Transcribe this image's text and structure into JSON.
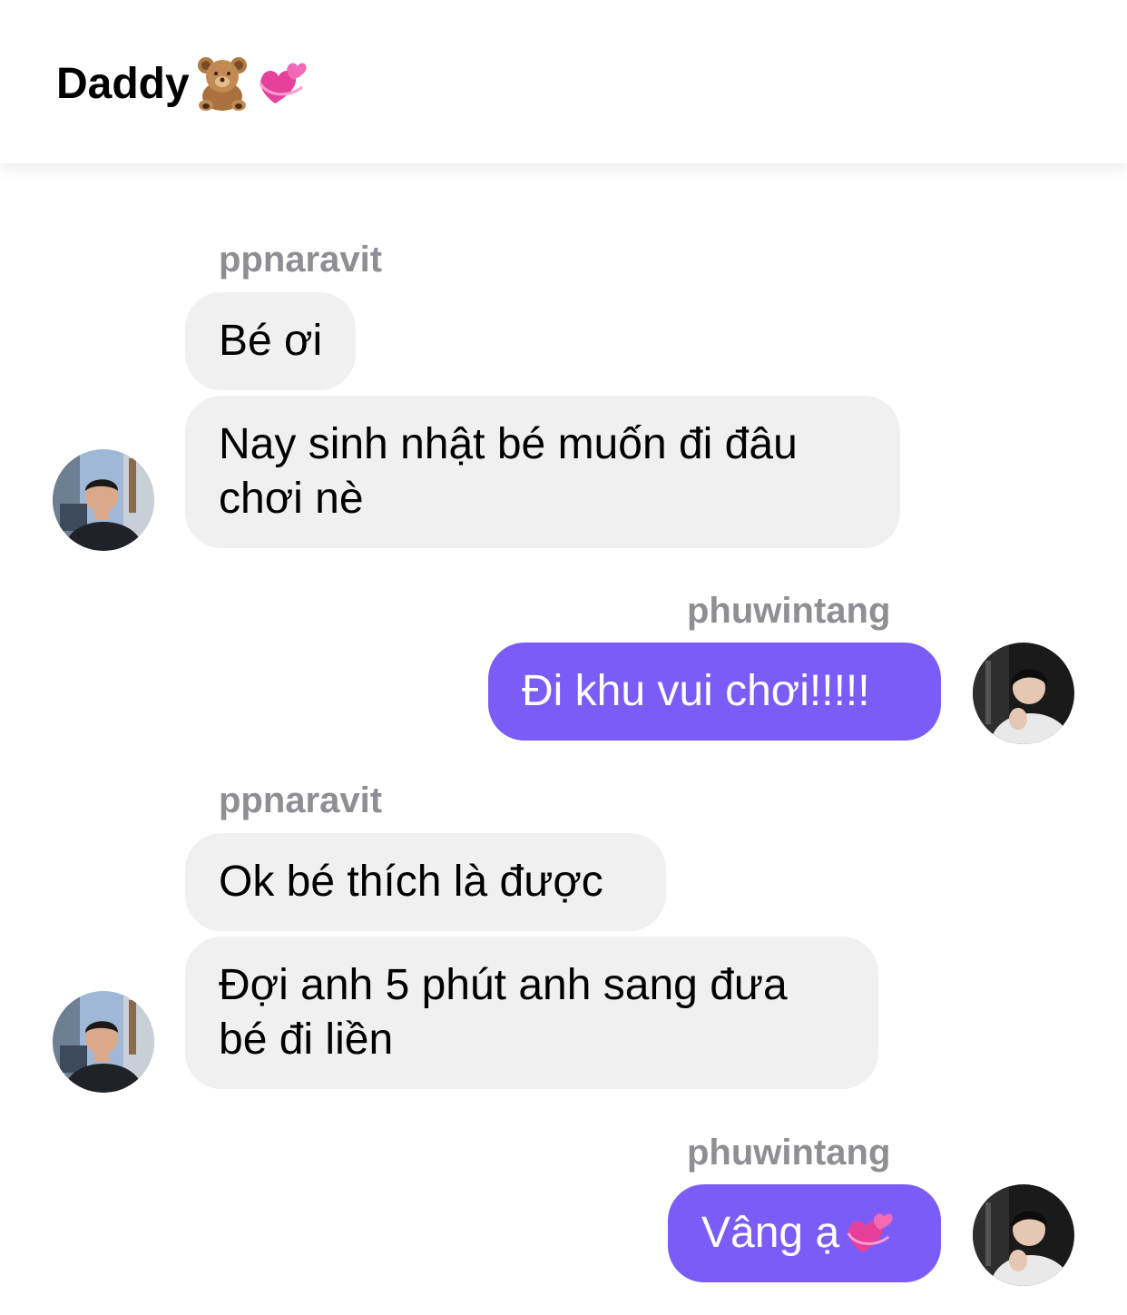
{
  "header": {
    "title": "Daddy",
    "title_emojis": [
      "teddy-bear",
      "revolving-hearts"
    ]
  },
  "messages": [
    {
      "sender": "ppnaravit",
      "direction": "incoming",
      "text": "Bé ơi"
    },
    {
      "sender": "ppnaravit",
      "direction": "incoming",
      "text": "Nay sinh nhật bé muốn đi đâu chơi nè"
    },
    {
      "sender": "phuwintang",
      "direction": "outgoing",
      "text": "Đi khu vui chơi!!!!!"
    },
    {
      "sender": "ppnaravit",
      "direction": "incoming",
      "text": "Ok bé thích là được"
    },
    {
      "sender": "ppnaravit",
      "direction": "incoming",
      "text": "Đợi anh 5 phút anh sang đưa bé đi liền"
    },
    {
      "sender": "phuwintang",
      "direction": "outgoing",
      "text": "Vâng ạ",
      "emoji": "revolving-hearts"
    }
  ],
  "names": {
    "incoming": "ppnaravit",
    "outgoing": "phuwintang"
  },
  "colors": {
    "outgoing_bubble": "#7c5cf6",
    "incoming_bubble": "#f0f0f0",
    "sender_name": "#8e8e93"
  }
}
